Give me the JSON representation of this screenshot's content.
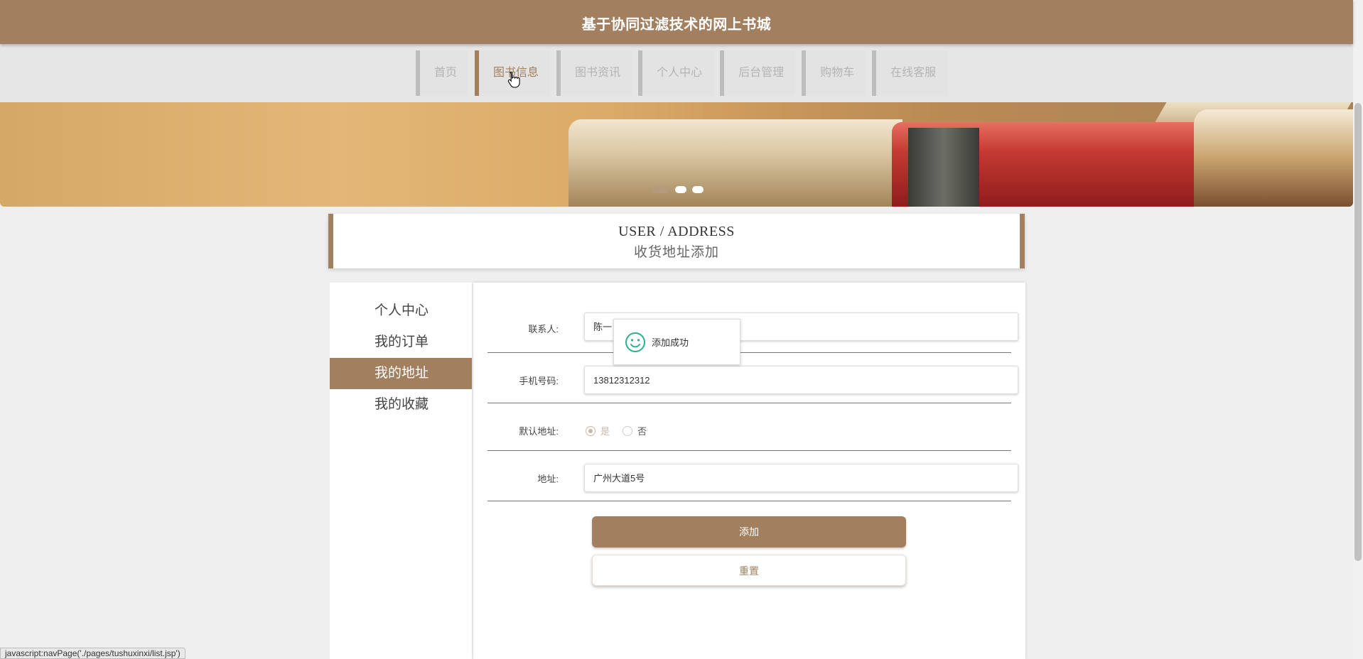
{
  "header": {
    "title": "基于协同过滤技术的网上书城"
  },
  "nav": {
    "items": [
      {
        "label": "首页",
        "active": false
      },
      {
        "label": "图书信息",
        "active": true
      },
      {
        "label": "图书资讯",
        "active": false
      },
      {
        "label": "个人中心",
        "active": false
      },
      {
        "label": "后台管理",
        "active": false
      },
      {
        "label": "购物车",
        "active": false
      },
      {
        "label": "在线客服",
        "active": false
      }
    ]
  },
  "banner": {
    "slide_count": 3,
    "active_slide": 1
  },
  "heading": {
    "en": "USER / ADDRESS",
    "cn": "收货地址添加"
  },
  "sidebar": {
    "items": [
      {
        "label": "个人中心",
        "active": false
      },
      {
        "label": "我的订单",
        "active": false
      },
      {
        "label": "我的地址",
        "active": true
      },
      {
        "label": "我的收藏",
        "active": false
      }
    ]
  },
  "form": {
    "contact": {
      "label": "联系人:",
      "value": "陈一"
    },
    "phone": {
      "label": "手机号码:",
      "value": "13812312312"
    },
    "default": {
      "label": "默认地址:",
      "yes": "是",
      "no": "否",
      "selected": "是"
    },
    "address": {
      "label": "地址:",
      "value": "广州大道5号"
    },
    "submit_label": "添加",
    "reset_label": "重置"
  },
  "toast": {
    "message": "添加成功",
    "icon": "smile-icon"
  },
  "status_bar": {
    "text": "javascript:navPage('./pages/tushuxinxi/list.jsp')"
  },
  "colors": {
    "primary": "#a2805f",
    "background": "#efefef",
    "nav_bg": "#e6e6e6"
  }
}
